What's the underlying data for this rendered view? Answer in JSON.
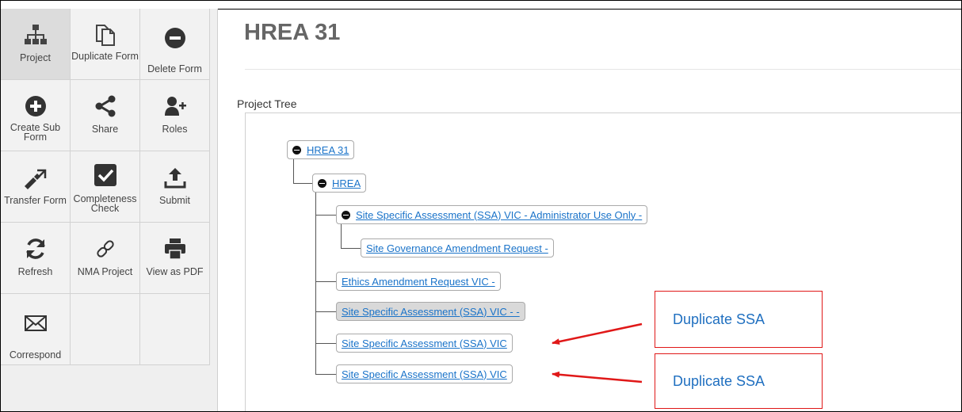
{
  "toolbar": {
    "items": [
      {
        "label": "Project",
        "icon": "sitemap-icon"
      },
      {
        "label": "Duplicate Form",
        "icon": "copy-icon"
      },
      {
        "label": "Delete Form",
        "icon": "minus-circle-icon"
      },
      {
        "label": "Create Sub Form",
        "icon": "plus-circle-icon"
      },
      {
        "label": "Share",
        "icon": "share-icon"
      },
      {
        "label": "Roles",
        "icon": "user-plus-icon"
      },
      {
        "label": "Transfer Form",
        "icon": "transfer-icon"
      },
      {
        "label": "Completeness Check",
        "icon": "checkbox-icon"
      },
      {
        "label": "Submit",
        "icon": "upload-icon"
      },
      {
        "label": "Refresh",
        "icon": "refresh-icon"
      },
      {
        "label": "NMA Project",
        "icon": "link-icon"
      },
      {
        "label": "View as PDF",
        "icon": "print-icon"
      },
      {
        "label": "Correspond",
        "icon": "envelope-icon"
      }
    ]
  },
  "page": {
    "title": "HREA 31",
    "tree_label": "Project Tree"
  },
  "tree": {
    "nodes": [
      {
        "label": "HREA 31",
        "expanded": true
      },
      {
        "label": "HREA",
        "expanded": true
      },
      {
        "label": "Site Specific Assessment (SSA) VIC - Administrator Use Only -",
        "expanded": true
      },
      {
        "label": "Site Governance Amendment Request -"
      },
      {
        "label": "Ethics Amendment Request VIC -"
      },
      {
        "label": "Site Specific Assessment (SSA) VIC - -",
        "selected": true
      },
      {
        "label": "Site Specific Assessment (SSA) VIC"
      },
      {
        "label": "Site Specific Assessment (SSA) VIC"
      }
    ]
  },
  "annotations": {
    "callouts": [
      "Duplicate SSA",
      "Duplicate SSA"
    ],
    "color": "#e01818"
  }
}
